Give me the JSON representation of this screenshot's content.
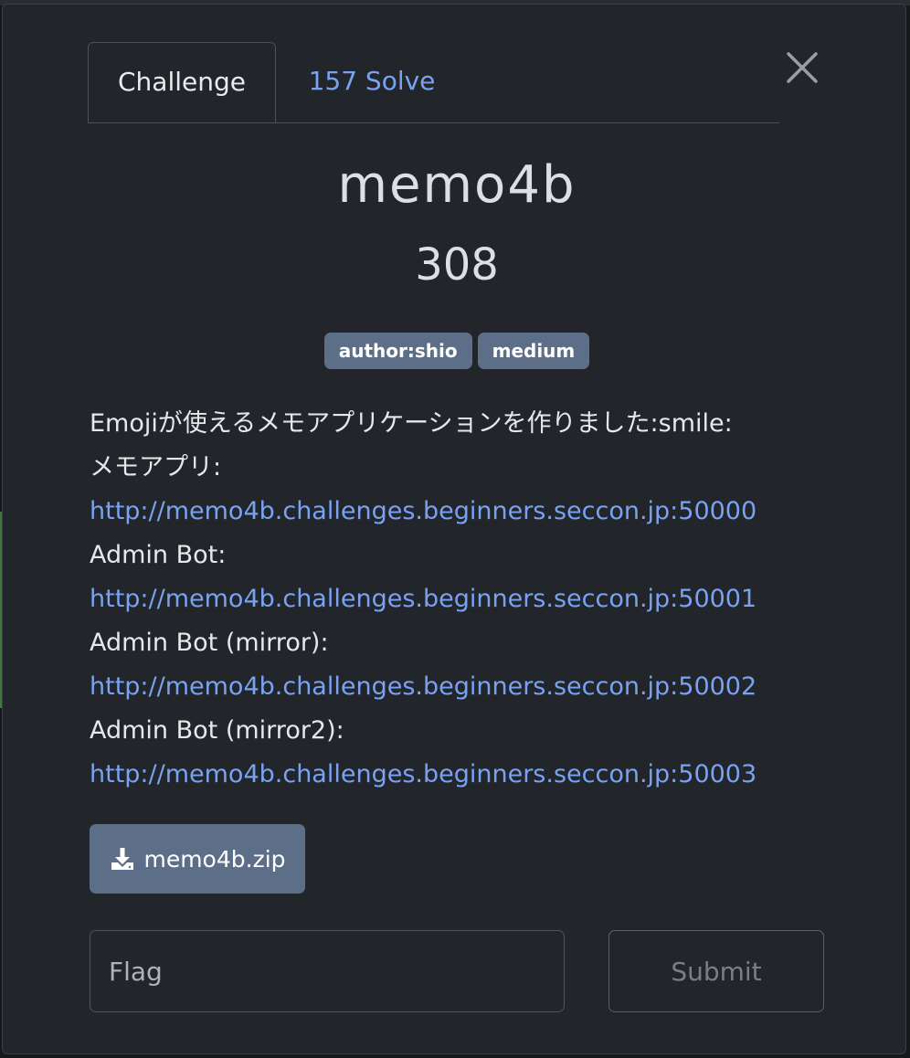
{
  "modal": {
    "tabs": [
      {
        "label": "Challenge",
        "active": true
      },
      {
        "label": "157 Solve",
        "active": false
      }
    ],
    "close_icon": "close-icon"
  },
  "challenge": {
    "name": "memo4b",
    "points": "308",
    "tags": [
      "author:shio",
      "medium"
    ],
    "description": {
      "intro": "Emojiが使えるメモアプリケーションを作りました:smile:",
      "memo_app_label": "メモアプリ:",
      "memo_app_url": "http://memo4b.challenges.beginners.seccon.jp:50000",
      "admin_bot_label": "Admin Bot:",
      "admin_bot_url": "http://memo4b.challenges.beginners.seccon.jp:50001",
      "admin_bot_mirror_label": "Admin Bot (mirror):",
      "admin_bot_mirror_url": "http://memo4b.challenges.beginners.seccon.jp:50002",
      "admin_bot_mirror2_label": "Admin Bot (mirror2):",
      "admin_bot_mirror2_url": "http://memo4b.challenges.beginners.seccon.jp:50003"
    },
    "file": {
      "name": "memo4b.zip",
      "icon": "download-icon"
    }
  },
  "submission": {
    "flag_placeholder": "Flag",
    "flag_value": "",
    "submit_label": "Submit"
  },
  "colors": {
    "background": "#22252a",
    "link": "#79a2f1",
    "badge": "#5d6e88",
    "text": "#e6e8eb"
  }
}
